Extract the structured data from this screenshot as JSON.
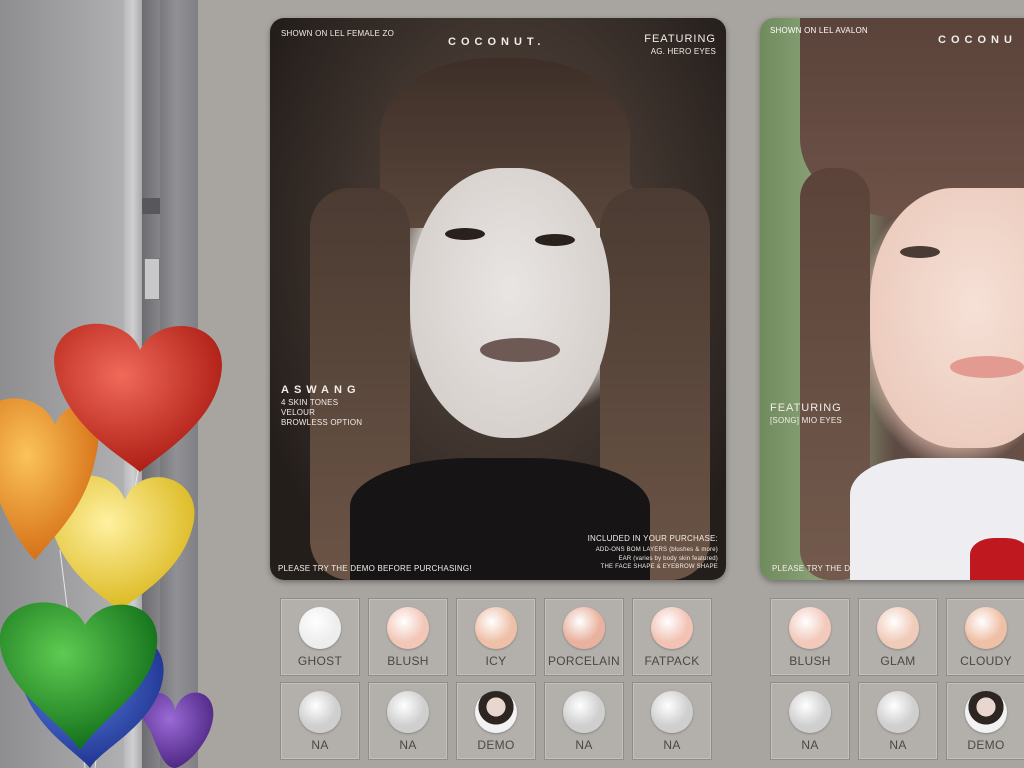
{
  "poster_left": {
    "shown_on": "SHOWN ON LEL FEMALE ZO",
    "brand": "COCONUT.",
    "featuring_title": "FEATURING",
    "featuring_item": "AG. HERO EYES",
    "model_name": "ASWANG",
    "features": [
      "4 SKIN TONES",
      "VELOUR",
      "BROWLESS OPTION"
    ],
    "included_title": "INCLUDED IN YOUR PURCHASE:",
    "included_items": [
      "ADD-ONS BOM LAYERS (blushes & more)",
      "EAR (varies by body skin featured)",
      "THE FACE SHAPE & EYEBROW SHAPE"
    ],
    "demo_note": "PLEASE TRY THE DEMO BEFORE PURCHASING!"
  },
  "poster_right": {
    "shown_on": "SHOWN ON LEL AVALON",
    "brand": "COCONU",
    "featuring_title": "FEATURING",
    "featuring_item": "[SONG] MIO EYES",
    "demo_note": "PLEASE TRY THE DEMO BEFORE PURCHASING!"
  },
  "swatches_left": [
    {
      "label": "GHOST",
      "color": "#eeeeee"
    },
    {
      "label": "BLUSH",
      "color": "#f2c7b8"
    },
    {
      "label": "ICY",
      "color": "#efc0a8"
    },
    {
      "label": "PORCELAIN",
      "color": "#e9b29e"
    },
    {
      "label": "FATPACK",
      "color": "#f2c3b5"
    },
    {
      "label": "NA",
      "color": "#cfcfcf"
    },
    {
      "label": "NA",
      "color": "#cfcfcf"
    },
    {
      "label": "DEMO",
      "color": "avatar"
    },
    {
      "label": "NA",
      "color": "#cfcfcf"
    },
    {
      "label": "NA",
      "color": "#cfcfcf"
    }
  ],
  "swatches_right": [
    {
      "label": "BLUSH",
      "color": "#f2c9bb"
    },
    {
      "label": "GLAM",
      "color": "#f1cbb9"
    },
    {
      "label": "CLOUDY",
      "color": "#efbfa6"
    },
    {
      "label": "NA",
      "color": "#cfcfcf"
    },
    {
      "label": "NA",
      "color": "#cfcfcf"
    },
    {
      "label": "DEMO",
      "color": "avatar"
    }
  ]
}
